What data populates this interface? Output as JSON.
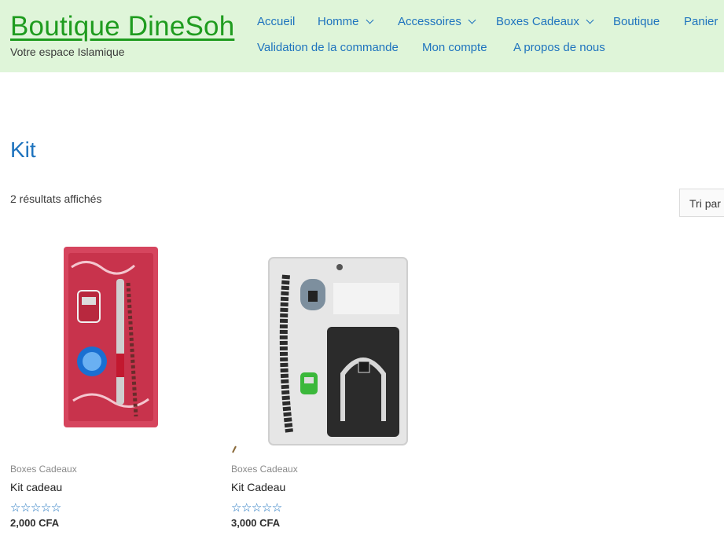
{
  "site": {
    "title": "Boutique DineSoh",
    "tagline": "Votre espace Islamique"
  },
  "nav": {
    "items": [
      {
        "label": "Accueil"
      },
      {
        "label": "Homme"
      },
      {
        "label": "Accessoires"
      },
      {
        "label": "Boxes Cadeaux"
      },
      {
        "label": "Boutique"
      },
      {
        "label": "Panier"
      },
      {
        "label": "Validation de la commande"
      },
      {
        "label": "Mon compte"
      },
      {
        "label": "A propos de nous"
      }
    ]
  },
  "page": {
    "title": "Kit",
    "result_count": "2 résultats affichés",
    "sort_label": "Tri par"
  },
  "products": [
    {
      "category": "Boxes Cadeaux",
      "name": "Kit cadeau",
      "rating_stars": "☆☆☆☆☆",
      "price": "2,000 CFA"
    },
    {
      "category": "Boxes Cadeaux",
      "name": "Kit Cadeau",
      "rating_stars": "☆☆☆☆☆",
      "price": "3,000 CFA"
    }
  ],
  "colors": {
    "header_bg": "#dff5d9",
    "site_title": "#1f9c1f",
    "link": "#1e73be"
  }
}
